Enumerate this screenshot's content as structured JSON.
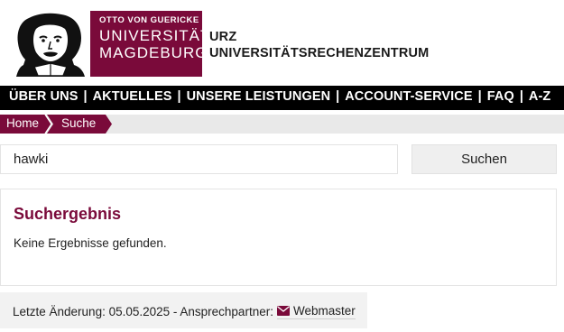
{
  "header": {
    "logo": {
      "line1": "OTTO VON GUERICKE",
      "line2": "UNIVERSITÄT",
      "line3": "MAGDEBURG"
    },
    "dept_short": "URZ",
    "dept_long": "UNIVERSITÄTSRECHENZENTRUM"
  },
  "nav": {
    "items": [
      "ÜBER UNS",
      "AKTUELLES",
      "UNSERE LEISTUNGEN",
      "ACCOUNT-SERVICE",
      "FAQ",
      "A-Z"
    ],
    "separator": "|"
  },
  "breadcrumb": {
    "items": [
      "Home",
      "Suche"
    ]
  },
  "search": {
    "value": "hawki",
    "button_label": "Suchen"
  },
  "results": {
    "title": "Suchergebnis",
    "message": "Keine Ergebnisse gefunden."
  },
  "footer": {
    "text": "Letzte Änderung: 05.05.2025 - Ansprechpartner:",
    "contact_label": "Webmaster"
  },
  "colors": {
    "brand": "#7a0a3a",
    "nav_bg": "#000000"
  }
}
